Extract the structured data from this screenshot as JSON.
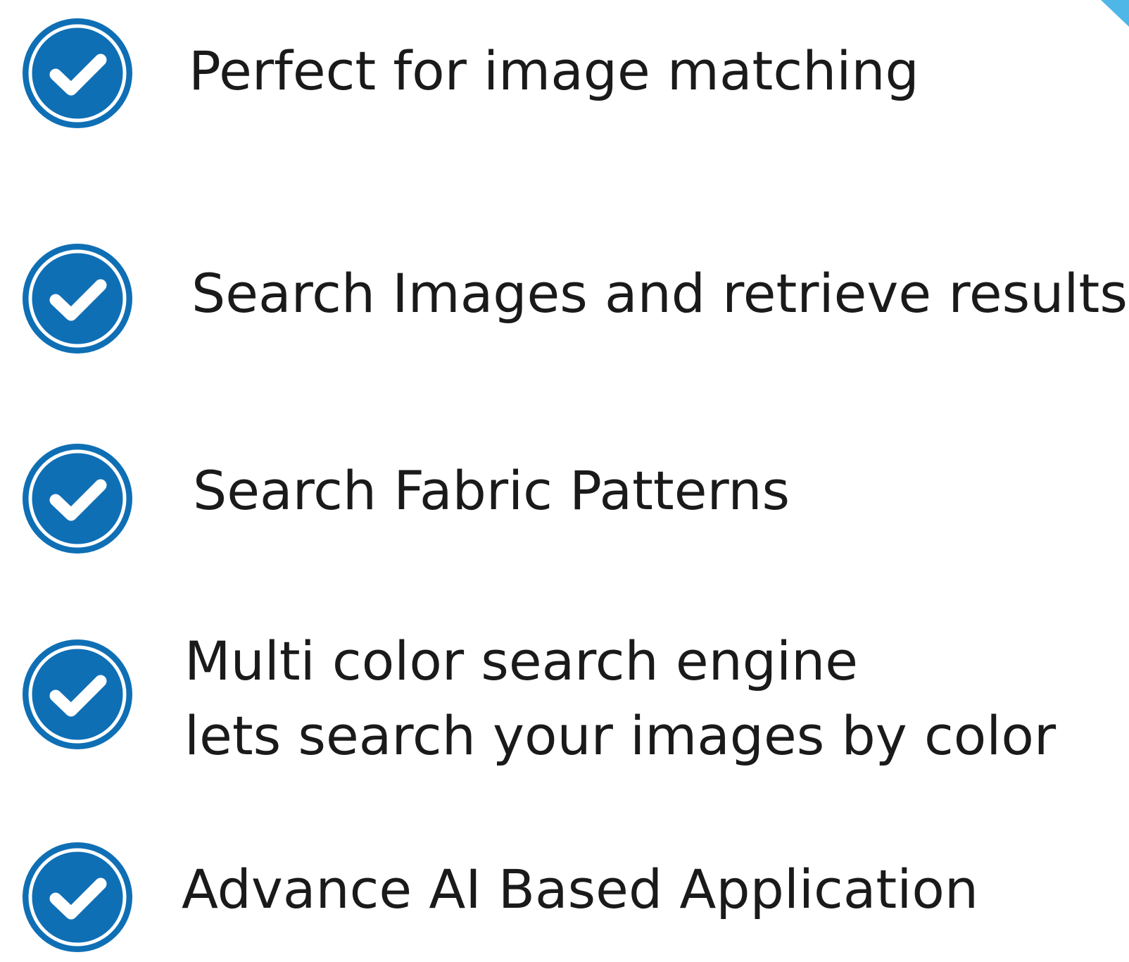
{
  "accent_color": "#0f6fb5",
  "check_icon": "check-circle-icon",
  "features": [
    {
      "lines": [
        "Perfect for image matching"
      ]
    },
    {
      "lines": [
        "Search Images and retrieve results"
      ]
    },
    {
      "lines": [
        "Search Fabric Patterns"
      ]
    },
    {
      "lines": [
        "Multi color search engine",
        "lets search your images by color"
      ]
    },
    {
      "lines": [
        "Advance AI Based Application"
      ]
    }
  ]
}
